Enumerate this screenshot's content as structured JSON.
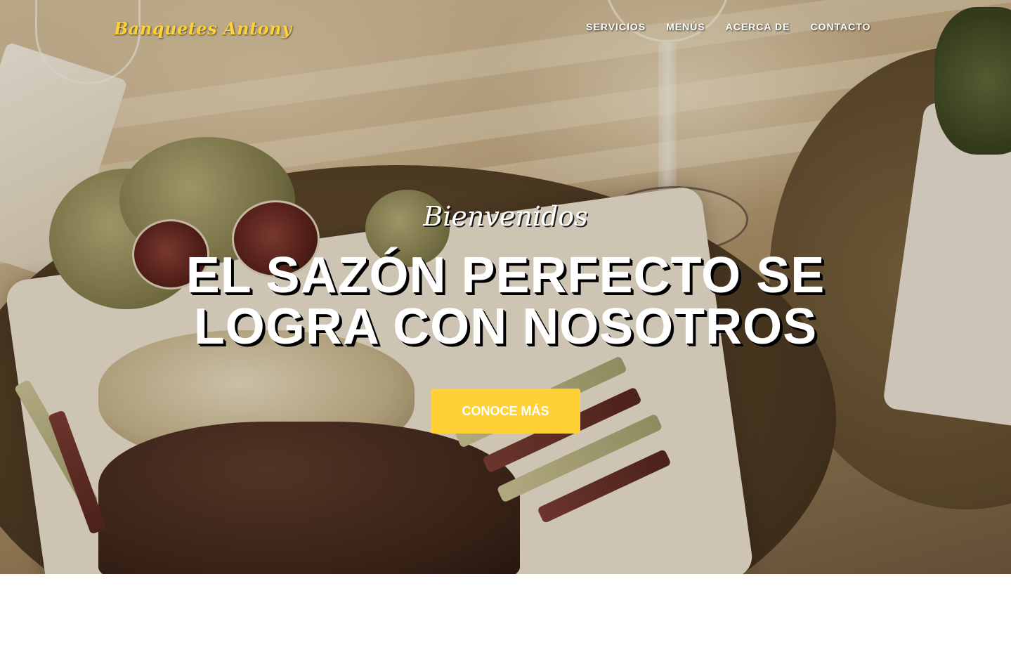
{
  "nav": {
    "brand": "Banquetes Antony",
    "links": [
      "Servicios",
      "Menús",
      "Acerca de",
      "Contacto"
    ]
  },
  "hero": {
    "lead": "Bienvenidos",
    "heading_line1": "EL SAZÓN PERFECTO SE",
    "heading_line2": "LOGRA CON NOSOTROS",
    "button_label": "CONOCE MÁS"
  },
  "colors": {
    "accent": "#fed136",
    "text": "#ffffff"
  }
}
